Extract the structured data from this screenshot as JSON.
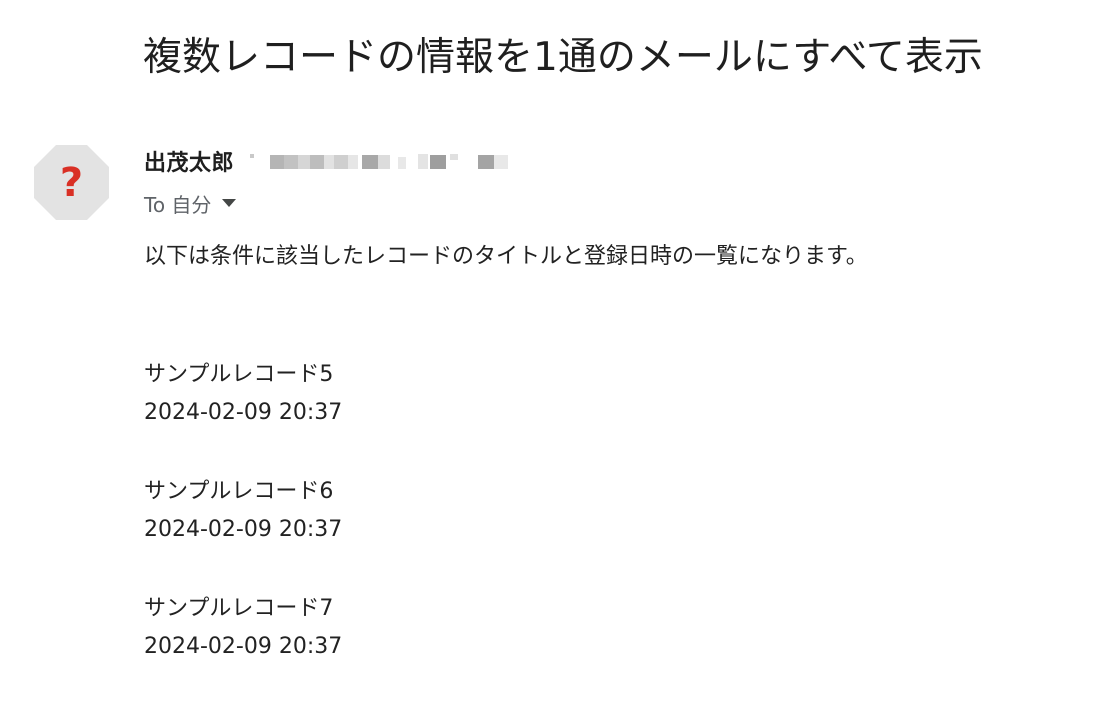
{
  "email": {
    "subject": "複数レコードの情報を1通のメールにすべて表示",
    "sender": {
      "name": "出茂太郎"
    },
    "recipient": {
      "label": "To 自分"
    },
    "body": {
      "intro": "以下は条件に該当したレコードのタイトルと登録日時の一覧になります。",
      "records": [
        {
          "title": "サンプルレコード5",
          "datetime": "2024-02-09 20:37"
        },
        {
          "title": "サンプルレコード6",
          "datetime": "2024-02-09 20:37"
        },
        {
          "title": "サンプルレコード7",
          "datetime": "2024-02-09 20:37"
        }
      ]
    }
  },
  "icons": {
    "avatar": "unknown-sender-question-icon",
    "recipient_caret": "caret-down-icon",
    "redacted_email": "pixelated-email-address"
  },
  "colors": {
    "avatar_bg": "#e0e0e0",
    "avatar_mark": "#d93025"
  }
}
